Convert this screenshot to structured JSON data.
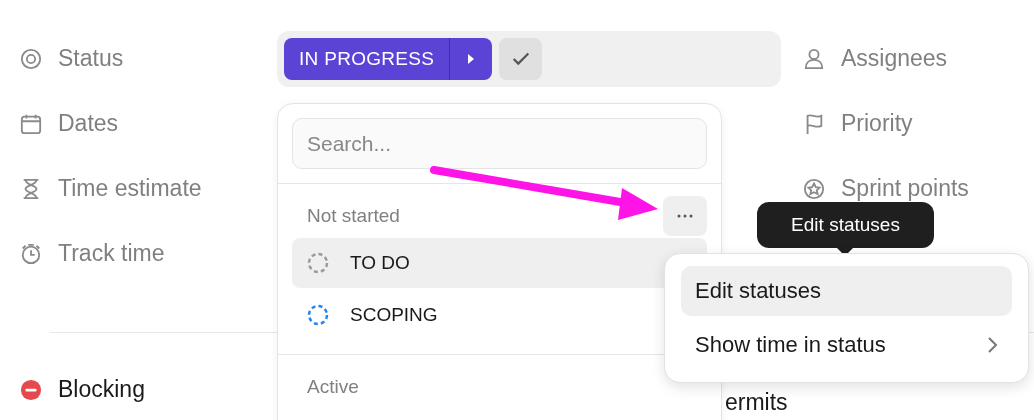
{
  "properties_left": [
    {
      "label": "Status"
    },
    {
      "label": "Dates"
    },
    {
      "label": "Time estimate"
    },
    {
      "label": "Track time"
    }
  ],
  "status_field": {
    "value": "IN PROGRESS"
  },
  "properties_right": [
    {
      "label": "Assignees"
    },
    {
      "label": "Priority"
    },
    {
      "label": "Sprint points"
    }
  ],
  "relationships": [
    {
      "label": "Blocking"
    },
    {
      "label": "ermits"
    }
  ],
  "status_dropdown": {
    "search": {
      "placeholder": "Search..."
    },
    "groups": [
      {
        "label": "Not started",
        "menu_open": true,
        "statuses": [
          {
            "name": "TO DO",
            "color": "#9a9a9a",
            "highlighted": true
          },
          {
            "name": "SCOPING",
            "color": "#1e88f0",
            "highlighted": false
          }
        ]
      },
      {
        "label": "Active",
        "menu_open": false
      }
    ]
  },
  "tooltip": {
    "text": "Edit statuses"
  },
  "group_menu": {
    "items": [
      {
        "label": "Edit statuses",
        "highlighted": true,
        "submenu": false
      },
      {
        "label": "Show time in status",
        "highlighted": false,
        "submenu": true
      }
    ]
  }
}
